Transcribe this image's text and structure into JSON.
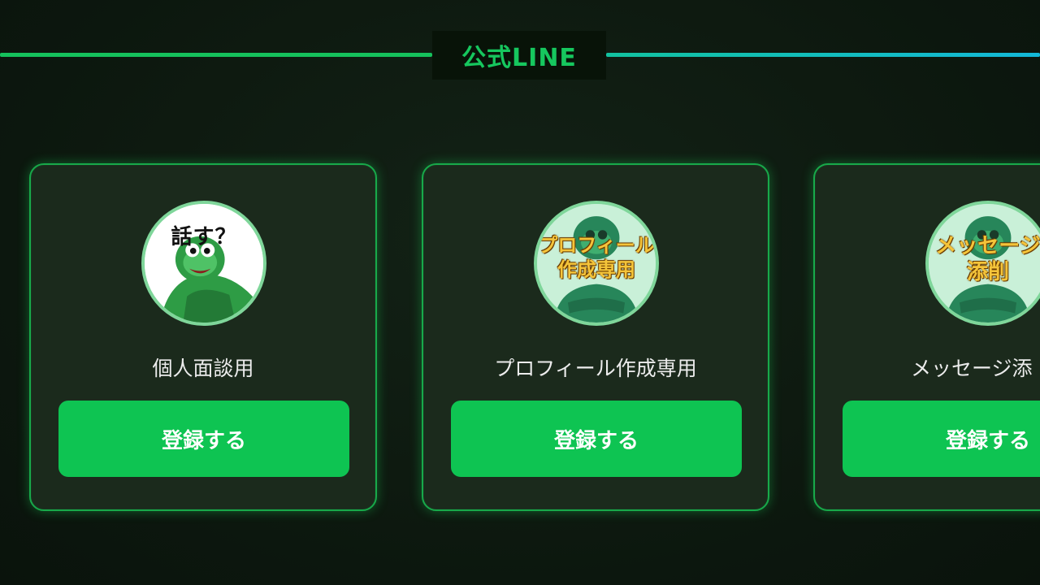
{
  "section": {
    "title": "公式LINE"
  },
  "cards": [
    {
      "name": "個人面談用",
      "avatar_caption": "話す？",
      "button_label": "登録する"
    },
    {
      "name": "プロフィール作成専用",
      "avatar_caption_line1": "プロフィール",
      "avatar_caption_line2": "作成専用",
      "button_label": "登録する"
    },
    {
      "name": "メッセージ添",
      "avatar_caption_line1": "メッセージ",
      "avatar_caption_line2": "添削",
      "button_label": "登録する"
    }
  ],
  "colors": {
    "accent_green": "#0ec452",
    "title_green": "#16c75e",
    "card_border": "#18a94a",
    "line_right_end": "#13b8d8",
    "avatar_ring": "#7fd69a",
    "caption_gold": "#f4c43a"
  },
  "icons": {
    "avatar_1": "frog-hoodie-talking-icon",
    "avatar_2": "frog-hoodie-profile-icon",
    "avatar_3": "frog-hoodie-message-icon"
  }
}
